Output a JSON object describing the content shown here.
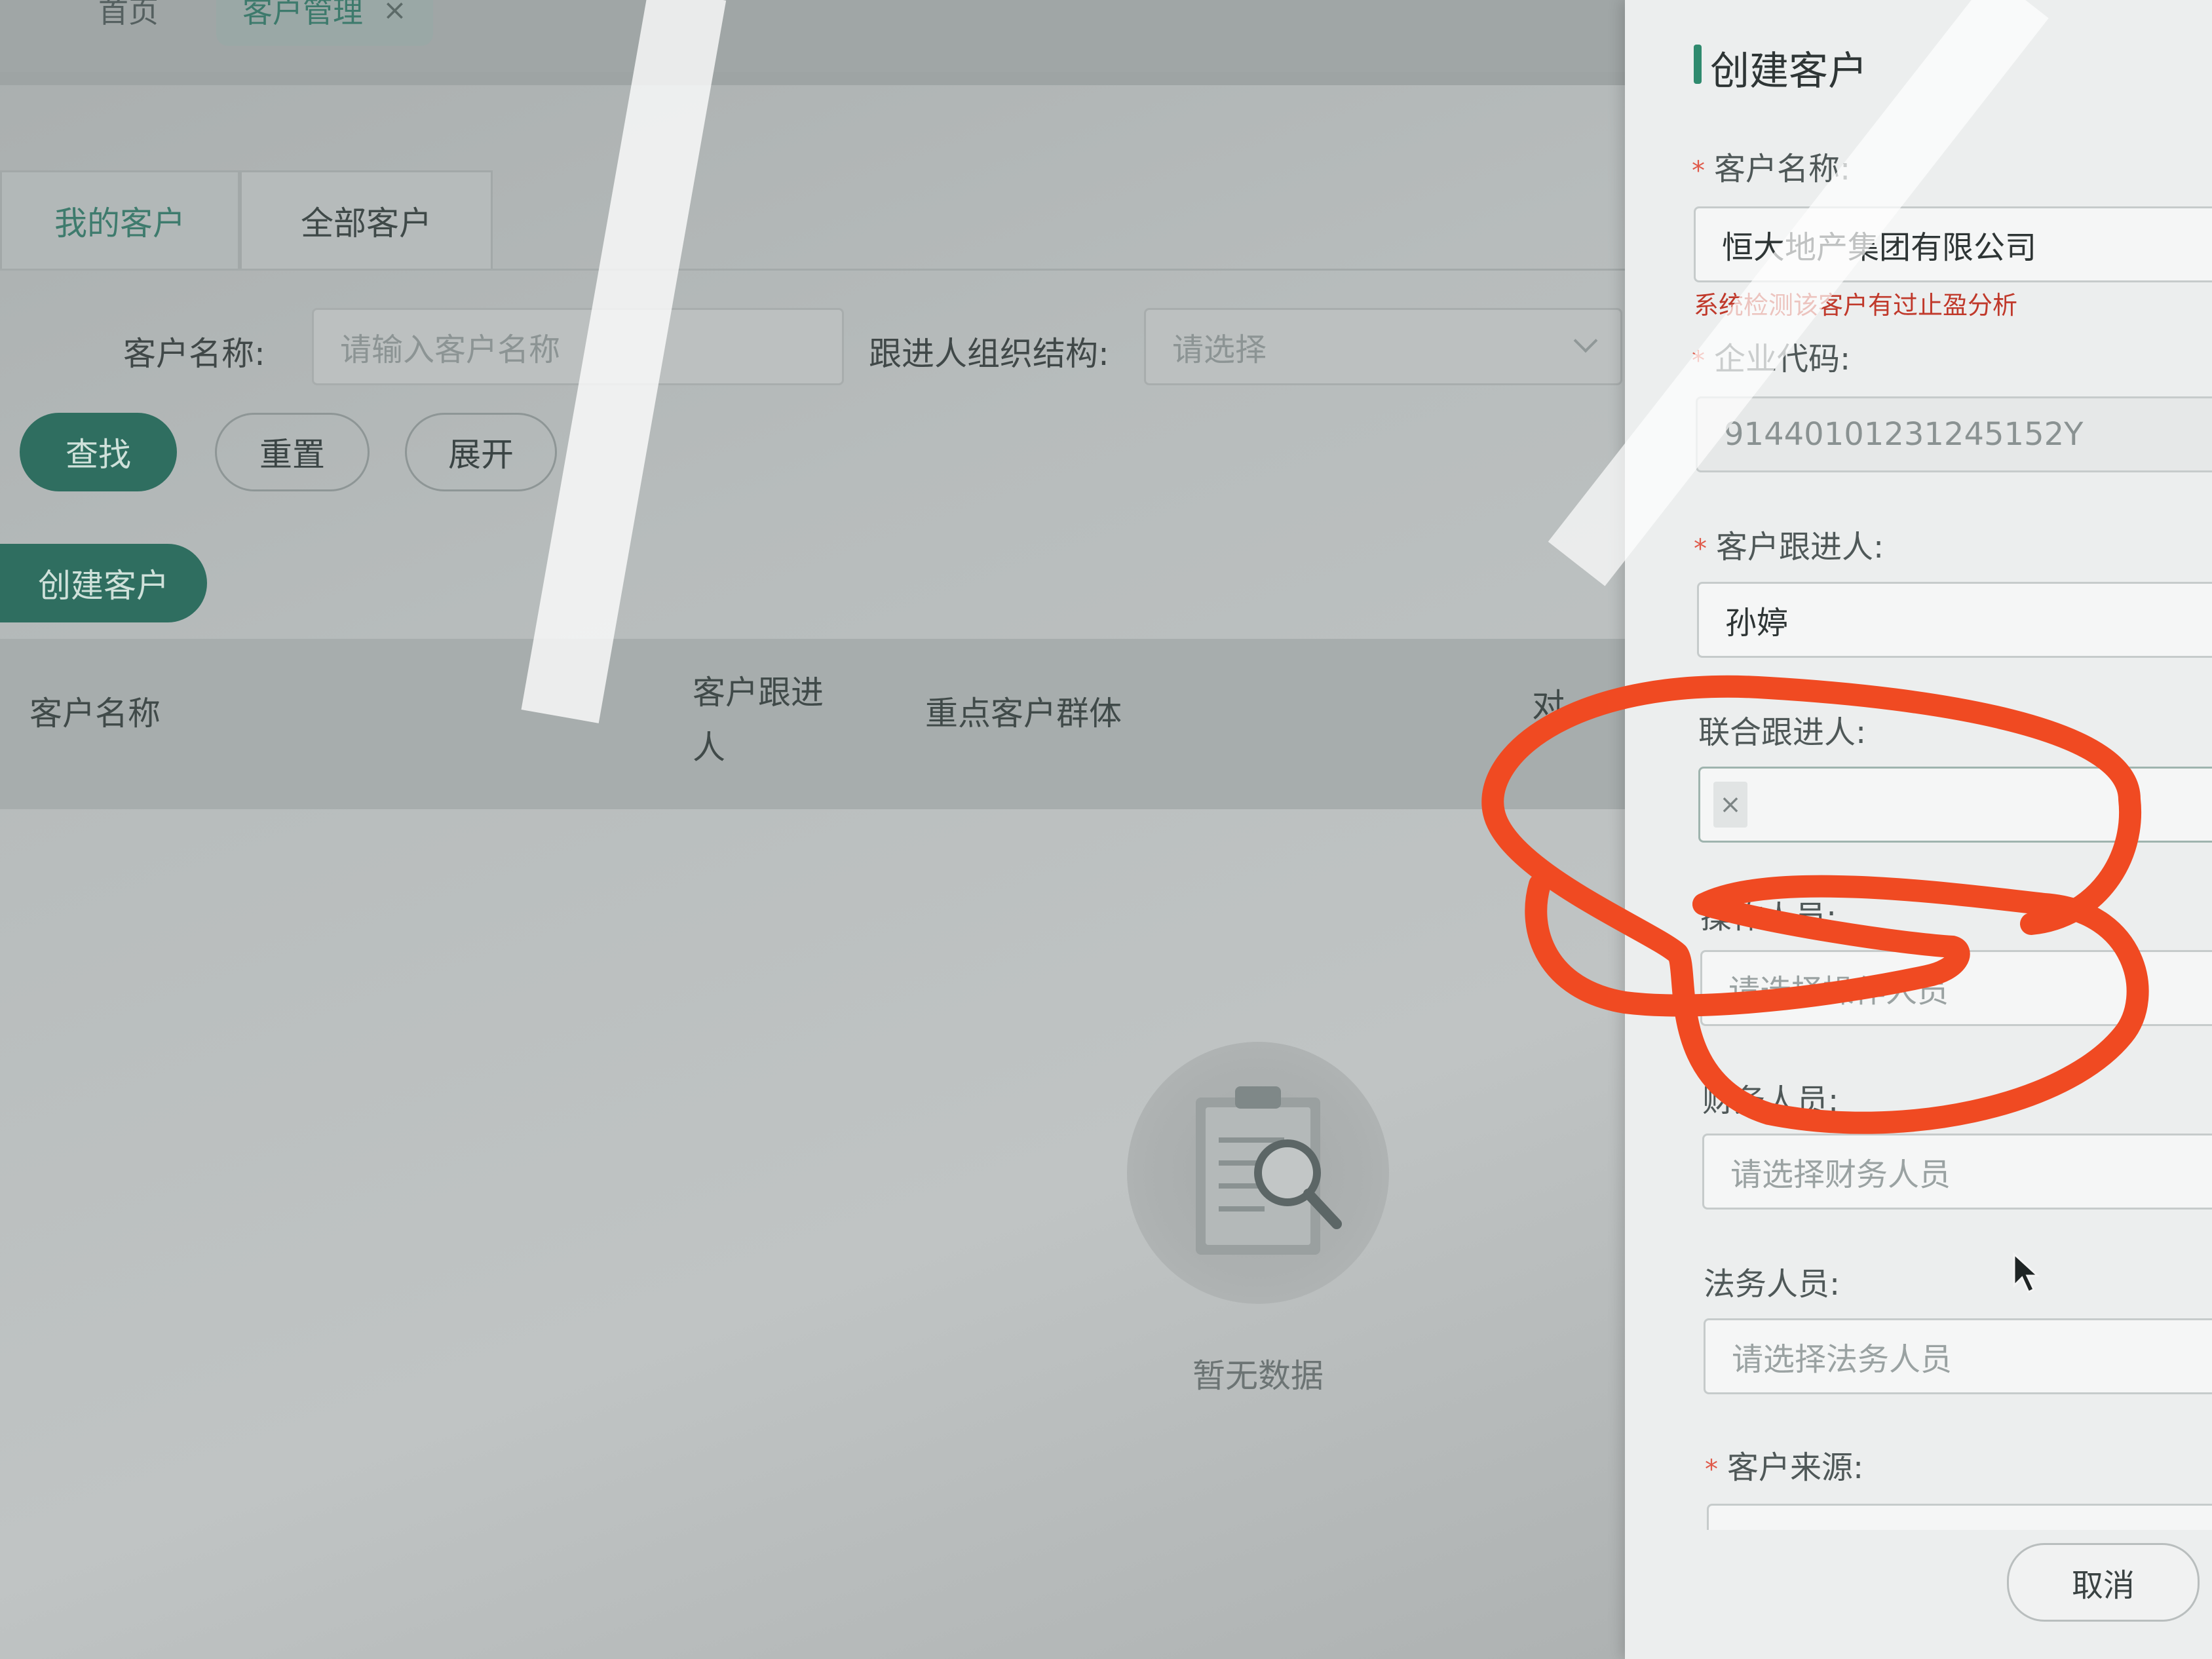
{
  "page_tabs": {
    "home": "首页",
    "active": "客户管理",
    "close": "×"
  },
  "list": {
    "tabs": [
      "我的客户",
      "全部客户"
    ],
    "filters": {
      "name_label": "客户名称:",
      "name_placeholder": "请输入客户名称",
      "org_label": "跟进人组织结构:",
      "org_placeholder": "请选择"
    },
    "buttons": {
      "search": "查找",
      "reset": "重置",
      "expand": "展开",
      "create": "创建客户"
    },
    "columns": [
      "客户名称",
      "客户跟进人",
      "重点客户群体",
      "对"
    ],
    "empty": "暂无数据"
  },
  "drawer": {
    "title": "创建客户",
    "fields": {
      "customer_name": {
        "label": "客户名称:",
        "required": true,
        "value": "恒大地产集团有限公司"
      },
      "warning": "系统检测该客户有过止盈分析",
      "company_code": {
        "label": "企业代码:",
        "required": true,
        "value": "91440101231245152Y"
      },
      "follower": {
        "label": "客户跟进人:",
        "required": true,
        "value": "孙婷"
      },
      "joint_follower": {
        "label": "联合跟进人:",
        "required": false,
        "tag_close": "×"
      },
      "operator": {
        "label": "操作人员:",
        "required": false,
        "placeholder": "请选择操作人员"
      },
      "finance": {
        "label": "财务人员:",
        "required": false,
        "placeholder": "请选择财务人员"
      },
      "legal": {
        "label": "法务人员:",
        "required": false,
        "placeholder": "请选择法务人员"
      },
      "source": {
        "label": "客户来源:",
        "required": true
      }
    },
    "cancel": "取消",
    "required_mark": "*"
  },
  "colors": {
    "primary": "#2f6e60",
    "annotation": "#f04a22",
    "warning": "#c0392b"
  }
}
